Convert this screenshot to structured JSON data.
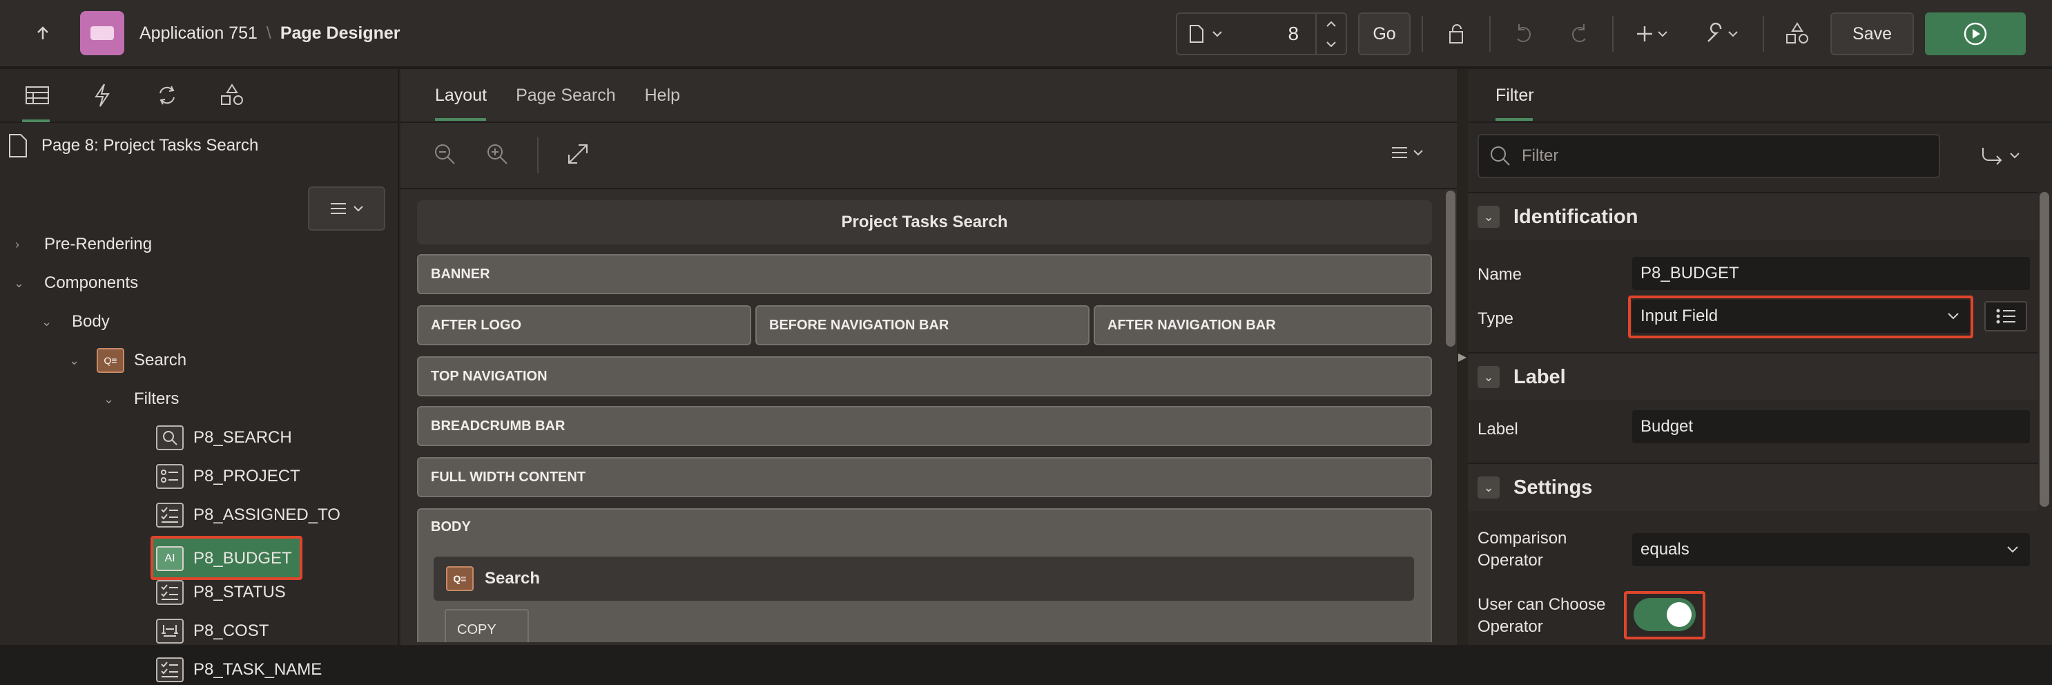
{
  "app": {
    "title": "Application 751",
    "section": "Page Designer",
    "separator": "\\"
  },
  "toolbar": {
    "page_value": "8",
    "go": "Go",
    "save": "Save"
  },
  "left": {
    "page_title": "Page 8: Project Tasks Search",
    "tree": [
      {
        "label": "Pre-Rendering",
        "icon": "chevron-right-icon"
      },
      {
        "label": "Components",
        "icon": "chevron-down-icon"
      },
      {
        "label": "Body",
        "icon": "chevron-down-icon"
      },
      {
        "label": "Search",
        "icon": "search-region-icon"
      },
      {
        "label": "Filters",
        "icon": "chevron-down-icon"
      },
      {
        "label": "P8_SEARCH",
        "icon": "search-icon"
      },
      {
        "label": "P8_PROJECT",
        "icon": "select-list-icon"
      },
      {
        "label": "P8_ASSIGNED_TO",
        "icon": "checkbox-list-icon"
      },
      {
        "label": "P8_BUDGET",
        "icon": "input-field-icon",
        "selected": true
      },
      {
        "label": "P8_STATUS",
        "icon": "checkbox-list-icon"
      },
      {
        "label": "P8_COST",
        "icon": "range-icon"
      },
      {
        "label": "P8_TASK_NAME",
        "icon": "checkbox-list-icon"
      }
    ]
  },
  "middle": {
    "tabs": [
      "Layout",
      "Page Search",
      "Help"
    ],
    "header": "Project Tasks Search",
    "regions": [
      "BANNER",
      "AFTER LOGO",
      "BEFORE NAVIGATION BAR",
      "AFTER NAVIGATION BAR",
      "TOP NAVIGATION",
      "BREADCRUMB BAR",
      "FULL WIDTH CONTENT",
      "BODY"
    ],
    "search_region": "Search",
    "copy": "COPY"
  },
  "right": {
    "tab": "Filter",
    "filter_placeholder": "Filter",
    "sections": {
      "identification": "Identification",
      "label": "Label",
      "settings": "Settings"
    },
    "props": {
      "name_label": "Name",
      "name_value": "P8_BUDGET",
      "type_label": "Type",
      "type_value": "Input Field",
      "label_label": "Label",
      "label_value": "Budget",
      "comp_label_1": "Comparison",
      "comp_label_2": "Operator",
      "comp_value": "equals",
      "user_label_1": "User can Choose",
      "user_label_2": "Operator"
    }
  },
  "colors": {
    "accent": "#3e7b52",
    "highlight": "#e0452c"
  }
}
